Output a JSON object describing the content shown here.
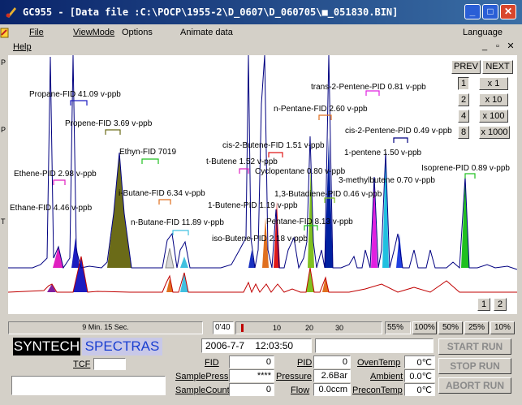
{
  "window": {
    "title": "GC955 - [Data file :C:\\POCP\\1955-2\\D_0607\\D_060705\\■_051830.BIN]",
    "min_icon": "minimize-icon",
    "max_icon": "maximize-icon",
    "close_icon": "close-icon"
  },
  "menu": {
    "file": "File",
    "viewmode": "ViewMode",
    "options": "Options",
    "animate": "Animate data",
    "language": "Language",
    "help": "Help",
    "mdi_min": "_",
    "mdi_restore": "▫",
    "mdi_close": "✕"
  },
  "side_ticks": [
    "P",
    "P",
    "T"
  ],
  "nav": {
    "prev": "PREV",
    "next": "NEXT",
    "pages": [
      "1",
      "2",
      "4",
      "8"
    ],
    "zooms": [
      "x 1",
      "x 10",
      "x 100",
      "x 1000"
    ],
    "channels": [
      "1",
      "2"
    ]
  },
  "peak_labels": [
    "Propane-FID 41.09 v-ppb",
    "Propene-FID 3.69 v-ppb",
    "Ethyn-FID 7019",
    "Ethene-PID 2.98 v-ppb",
    "Ethane-FID 4.46 v-ppb",
    "i-Butane-FID 6.34 v-ppb",
    "n-Butane-FID 11.89 v-ppb",
    "t-Butene 1.52 v-ppb",
    "cis-2-Butene-FID 1.51 v-ppb",
    "Cyclopentane 0.80 v-ppb",
    "1-Butene-PID 1.19 v-ppb",
    "1,3-Butadiene-PID 0.46 v-ppb",
    "iso-Butene-PID 2.18 v-ppb",
    "Pentane-FID 8.13 v-ppb",
    "n-Pentane-FID 2.60 v-ppb",
    "trans-2-Pentene-PID 0.81 v-ppb",
    "cis-2-Pentene-PID 0.49 v-ppb",
    "1-pentene 1.50 v-ppb",
    "3-methylbutene 0.70 v-ppb",
    "Isoprene-PID 0.89 v-ppb"
  ],
  "status": {
    "elapsed": "9 Min. 15 Sec.",
    "time_marker": "0'40",
    "scale_ticks": [
      "10",
      "20",
      "30"
    ],
    "percent": "55%",
    "zoom_options": [
      "100%",
      "50%",
      "25%",
      "10%"
    ]
  },
  "brand": {
    "syntech": "SYNTECH",
    "spectras": "SPECTRAS",
    "syntech_bg": "#000000",
    "spectras_color": "#1a3fd0"
  },
  "readout": {
    "datetime": "2006-7-7    12:03:50",
    "tcf_label": "TCF",
    "fid_label": "FID",
    "fid_value": "0",
    "samplepress_label": "SamplePress",
    "samplepress_value": "****",
    "samplecount_label": "SampleCount",
    "samplecount_value": "0",
    "pid_label": "PID",
    "pid_value": "0",
    "pressure_label": "Pressure",
    "pressure_value": "2.6Bar",
    "flow_label": "Flow",
    "flow_value": "0.0ccm",
    "oventemp_label": "OvenTemp",
    "oventemp_value": "0℃",
    "ambient_label": "Ambient",
    "ambient_value": "0.0℃",
    "precontemp_label": "PreconTemp",
    "precontemp_value": "0℃"
  },
  "buttons": {
    "start": "START RUN",
    "stop": "STOP RUN",
    "abort": "ABORT RUN"
  },
  "colors": {
    "fid_trace": "#000080",
    "pid_trace": "#c00000"
  }
}
